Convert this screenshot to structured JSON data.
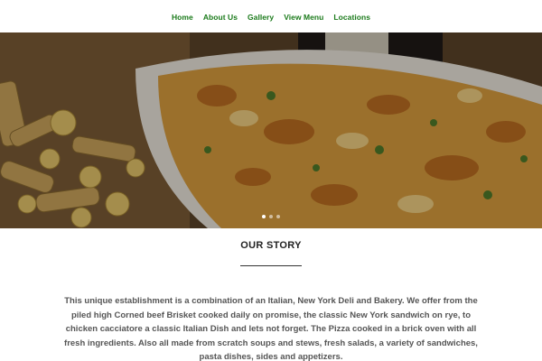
{
  "nav": {
    "items": [
      "Home",
      "About Us",
      "Gallery",
      "View Menu",
      "Locations"
    ]
  },
  "hero": {
    "slide_count": 3,
    "active_slide": 1
  },
  "story": {
    "heading": "OUR STORY",
    "body": "This unique establishment is a combination of an Italian, New York Deli and Bakery. We offer from the piled high Corned beef Brisket cooked daily on promise, the classic New York sandwich on rye, to chicken cacciatore a classic Italian Dish and lets not forget. The Pizza cooked in a brick oven with all fresh ingredients. Also all made from scratch soups and stews, fresh salads, a variety of sandwiches, pasta dishes, sides and appetizers."
  },
  "colors": {
    "nav_link": "#1a7a1a",
    "heading": "#222222",
    "body_text": "#555555"
  }
}
